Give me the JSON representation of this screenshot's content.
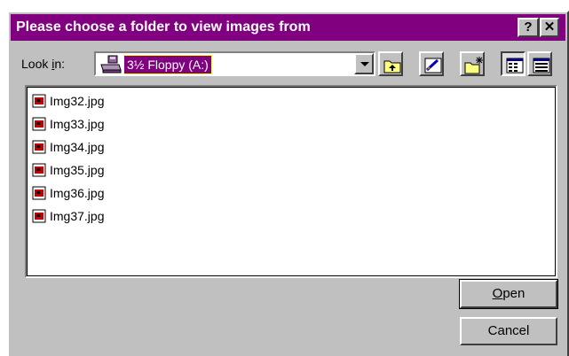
{
  "dialog": {
    "title": "Please choose a folder to view images from",
    "help_glyph": "?",
    "close_glyph": "✕"
  },
  "lookin": {
    "label_prefix": "Look ",
    "label_hotkey": "i",
    "label_suffix": "n:",
    "value": "3½ Floppy (A:)",
    "icon": "floppy-drive-icon"
  },
  "toolbar": {
    "icons": [
      "up-one-level-icon",
      "look-in-favorites-icon",
      "create-new-folder-icon",
      "list-view-icon",
      "details-view-icon"
    ]
  },
  "files": [
    {
      "name": "Img32.jpg",
      "icon": "jpg-file-icon"
    },
    {
      "name": "Img33.jpg",
      "icon": "jpg-file-icon"
    },
    {
      "name": "Img34.jpg",
      "icon": "jpg-file-icon"
    },
    {
      "name": "Img35.jpg",
      "icon": "jpg-file-icon"
    },
    {
      "name": "Img36.jpg",
      "icon": "jpg-file-icon"
    },
    {
      "name": "Img37.jpg",
      "icon": "jpg-file-icon"
    }
  ],
  "buttons": {
    "open_hotkey": "O",
    "open_rest": "pen",
    "cancel": "Cancel"
  },
  "colors": {
    "titlebar": "#800080",
    "face": "#c0c0c0",
    "selection": "#800080"
  }
}
